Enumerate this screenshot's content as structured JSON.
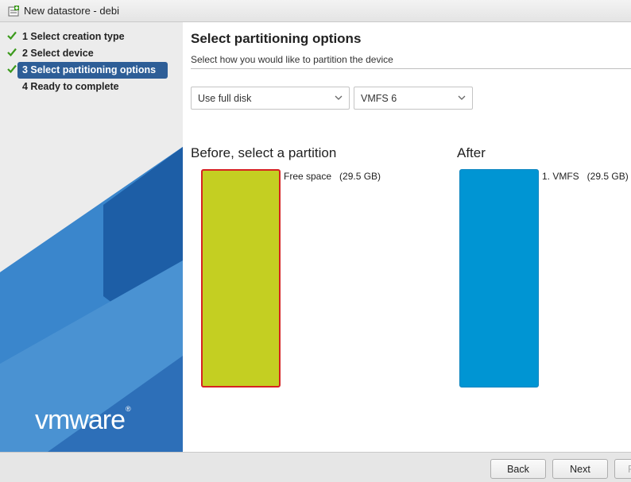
{
  "window": {
    "title": "New datastore - debi"
  },
  "sidebar": {
    "steps": [
      {
        "label": "1 Select creation type",
        "completed": true
      },
      {
        "label": "2 Select device",
        "completed": true
      },
      {
        "label": "3 Select partitioning options",
        "completed": true,
        "active": true
      },
      {
        "label": "4 Ready to complete",
        "completed": false
      }
    ],
    "logo_text": "vmware",
    "logo_mark": "®"
  },
  "main": {
    "title": "Select partitioning options",
    "subtitle": "Select how you would like to partition the device",
    "partition_select": {
      "value": "Use full disk"
    },
    "vmfs_select": {
      "value": "VMFS 6"
    },
    "before": {
      "heading": "Before, select a partition",
      "partition_label": "Free space   (29.5 GB)"
    },
    "after": {
      "heading": "After",
      "partition_label": "1. VMFS   (29.5 GB)"
    }
  },
  "footer": {
    "back_label": "Back",
    "next_label": "Next",
    "finish_label": "F"
  },
  "colors": {
    "active_step": "#2e5e97",
    "check": "#3b9a1c",
    "before_bar": "#c4cf22",
    "before_border": "#d62222",
    "after_bar": "#0095d3"
  }
}
